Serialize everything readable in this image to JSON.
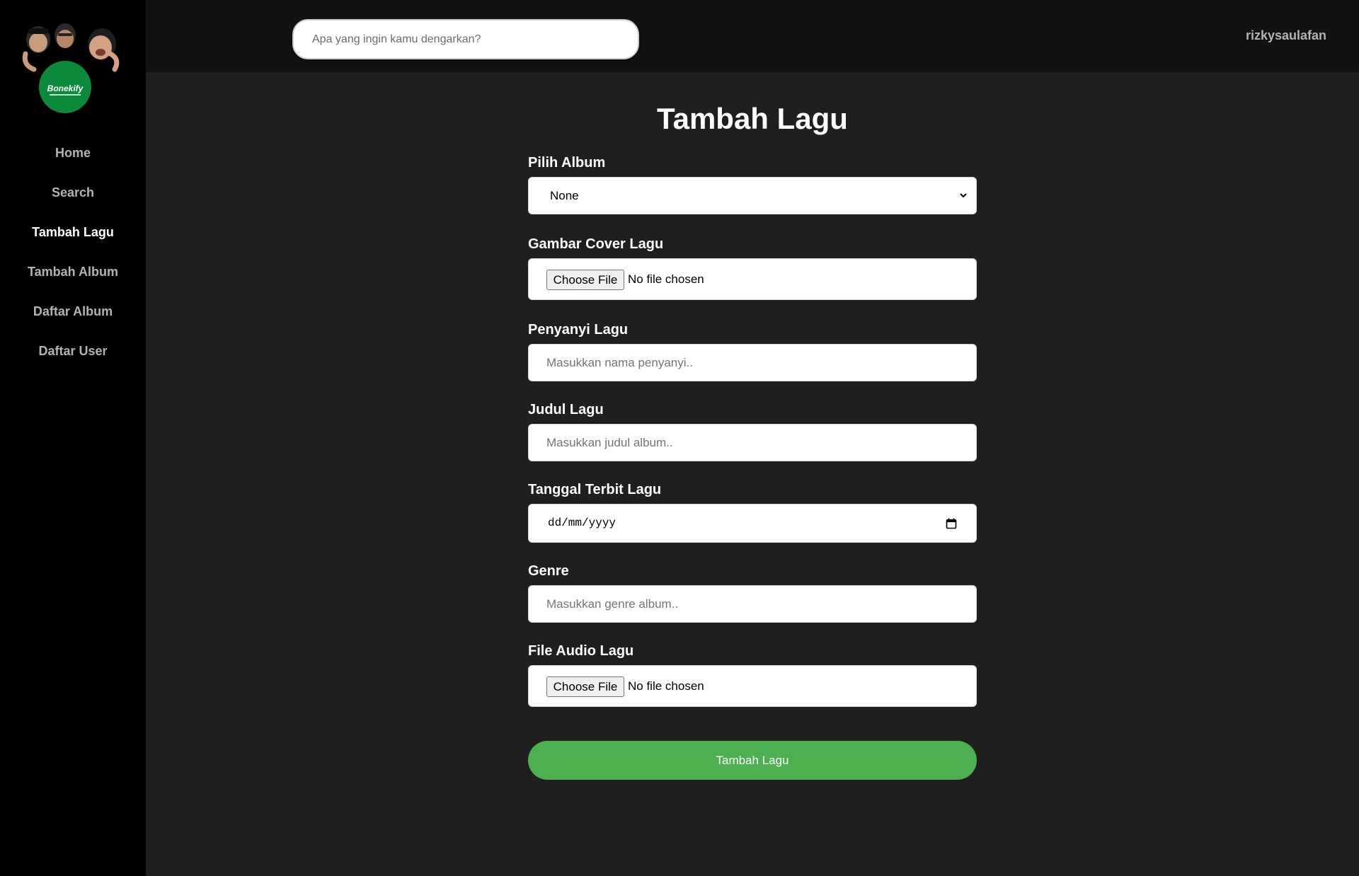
{
  "app": {
    "logo_text": "Bonekify"
  },
  "sidebar": {
    "items": [
      {
        "label": "Home",
        "active": false
      },
      {
        "label": "Search",
        "active": false
      },
      {
        "label": "Tambah Lagu",
        "active": true
      },
      {
        "label": "Tambah Album",
        "active": false
      },
      {
        "label": "Daftar Album",
        "active": false
      },
      {
        "label": "Daftar User",
        "active": false
      }
    ]
  },
  "header": {
    "search_placeholder": "Apa yang ingin kamu dengarkan?",
    "username": "rizkysaulafan"
  },
  "main": {
    "title": "Tambah Lagu",
    "fields": {
      "album": {
        "label": "Pilih Album",
        "value": "None"
      },
      "cover": {
        "label": "Gambar Cover Lagu",
        "button": "Choose File",
        "status": "No file chosen"
      },
      "singer": {
        "label": "Penyanyi Lagu",
        "placeholder": "Masukkan nama penyanyi.."
      },
      "title": {
        "label": "Judul Lagu",
        "placeholder": "Masukkan judul album.."
      },
      "date": {
        "label": "Tanggal Terbit Lagu",
        "placeholder": "dd/mm/yyyy"
      },
      "genre": {
        "label": "Genre",
        "placeholder": "Masukkan genre album.."
      },
      "audio": {
        "label": "File Audio Lagu",
        "button": "Choose File",
        "status": "No file chosen"
      }
    },
    "submit_label": "Tambah Lagu"
  },
  "colors": {
    "accent": "#4caf50",
    "logo_green": "#0a8a3a",
    "sidebar_bg": "#000000",
    "topbar_bg": "#121212",
    "content_bg": "#1f1f1f"
  }
}
